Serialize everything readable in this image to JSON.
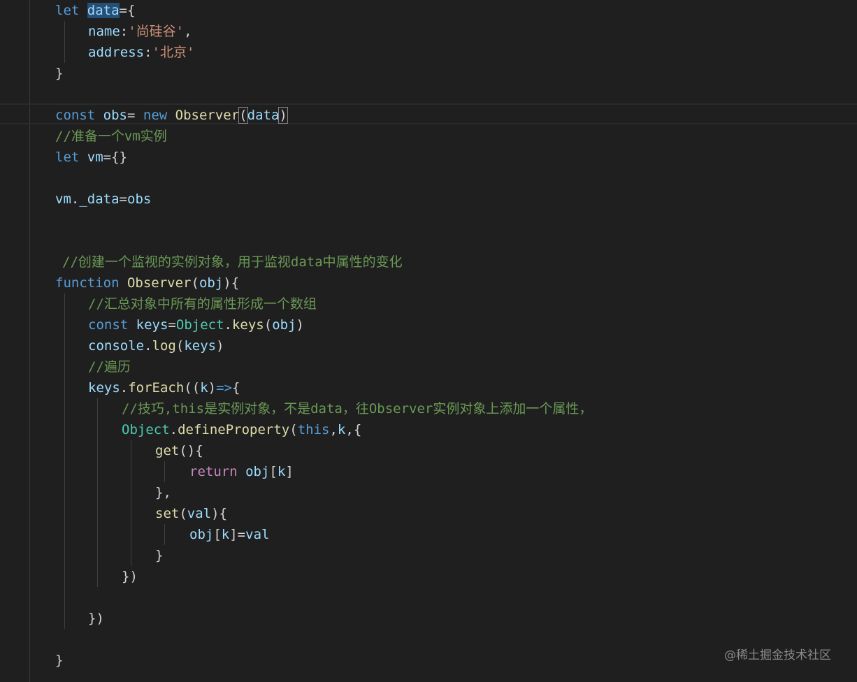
{
  "editor": {
    "lines": [
      [
        {
          "t": "let",
          "c": "kw"
        },
        {
          "t": " "
        },
        {
          "t": "data",
          "c": "var hl"
        },
        {
          "t": "={"
        }
      ],
      [
        {
          "t": "name",
          "c": "var"
        },
        {
          "t": ":"
        },
        {
          "t": "'尚硅谷'",
          "c": "str"
        },
        {
          "t": ","
        }
      ],
      [
        {
          "t": "address",
          "c": "var"
        },
        {
          "t": ":"
        },
        {
          "t": "'北京'",
          "c": "str"
        }
      ],
      [
        {
          "t": "}"
        }
      ],
      [],
      [
        {
          "t": "const",
          "c": "kw"
        },
        {
          "t": " "
        },
        {
          "t": "obs",
          "c": "var"
        },
        {
          "t": "= "
        },
        {
          "t": "new",
          "c": "kw"
        },
        {
          "t": " "
        },
        {
          "t": "Observer",
          "c": "fn"
        },
        {
          "t": "(",
          "c": "pun bracket-match"
        },
        {
          "t": "data",
          "c": "var"
        },
        {
          "t": ")",
          "c": "pun bracket-match"
        }
      ],
      [
        {
          "t": "//准备一个vm实例",
          "c": "cmt"
        }
      ],
      [
        {
          "t": "let",
          "c": "kw"
        },
        {
          "t": " "
        },
        {
          "t": "vm",
          "c": "var"
        },
        {
          "t": "={}"
        }
      ],
      [],
      [
        {
          "t": "vm",
          "c": "var"
        },
        {
          "t": "."
        },
        {
          "t": "_data",
          "c": "var"
        },
        {
          "t": "="
        },
        {
          "t": "obs",
          "c": "var"
        }
      ],
      [],
      [],
      [
        {
          "t": "//创建一个监视的实例对象，用于监视data中属性的变化",
          "c": "cmt"
        }
      ],
      [
        {
          "t": "function",
          "c": "kw"
        },
        {
          "t": " "
        },
        {
          "t": "Observer",
          "c": "fn"
        },
        {
          "t": "("
        },
        {
          "t": "obj",
          "c": "var"
        },
        {
          "t": "){"
        }
      ],
      [
        {
          "t": "//汇总对象中所有的属性形成一个数组",
          "c": "cmt"
        }
      ],
      [
        {
          "t": "const",
          "c": "kw"
        },
        {
          "t": " "
        },
        {
          "t": "keys",
          "c": "var"
        },
        {
          "t": "="
        },
        {
          "t": "Object",
          "c": "cls"
        },
        {
          "t": "."
        },
        {
          "t": "keys",
          "c": "fn"
        },
        {
          "t": "("
        },
        {
          "t": "obj",
          "c": "var"
        },
        {
          "t": ")"
        }
      ],
      [
        {
          "t": "console",
          "c": "var"
        },
        {
          "t": "."
        },
        {
          "t": "log",
          "c": "fn"
        },
        {
          "t": "("
        },
        {
          "t": "keys",
          "c": "var"
        },
        {
          "t": ")"
        }
      ],
      [
        {
          "t": "//遍历",
          "c": "cmt"
        }
      ],
      [
        {
          "t": "keys",
          "c": "var"
        },
        {
          "t": "."
        },
        {
          "t": "forEach",
          "c": "fn"
        },
        {
          "t": "(("
        },
        {
          "t": "k",
          "c": "var"
        },
        {
          "t": ")"
        },
        {
          "t": "=>",
          "c": "kw"
        },
        {
          "t": "{"
        }
      ],
      [
        {
          "t": "//技巧,this是实例对象，不是data，往Observer实例对象上添加一个属性，",
          "c": "cmt"
        }
      ],
      [
        {
          "t": "Object",
          "c": "cls"
        },
        {
          "t": "."
        },
        {
          "t": "defineProperty",
          "c": "fn"
        },
        {
          "t": "("
        },
        {
          "t": "this",
          "c": "kw"
        },
        {
          "t": ","
        },
        {
          "t": "k",
          "c": "var"
        },
        {
          "t": ",{"
        }
      ],
      [
        {
          "t": "get",
          "c": "fn"
        },
        {
          "t": "(){"
        }
      ],
      [
        {
          "t": "return",
          "c": "ctrl"
        },
        {
          "t": " "
        },
        {
          "t": "obj",
          "c": "var"
        },
        {
          "t": "["
        },
        {
          "t": "k",
          "c": "var"
        },
        {
          "t": "]"
        }
      ],
      [
        {
          "t": "},"
        }
      ],
      [
        {
          "t": "set",
          "c": "fn"
        },
        {
          "t": "("
        },
        {
          "t": "val",
          "c": "var"
        },
        {
          "t": "){"
        }
      ],
      [
        {
          "t": "obj",
          "c": "var"
        },
        {
          "t": "["
        },
        {
          "t": "k",
          "c": "var"
        },
        {
          "t": "]="
        },
        {
          "t": "val",
          "c": "var"
        }
      ],
      [
        {
          "t": "}"
        }
      ],
      [
        {
          "t": "})"
        }
      ],
      [],
      [
        {
          "t": "})"
        }
      ],
      [],
      [
        {
          "t": "}"
        }
      ]
    ]
  },
  "watermark": "@稀土掘金技术社区"
}
